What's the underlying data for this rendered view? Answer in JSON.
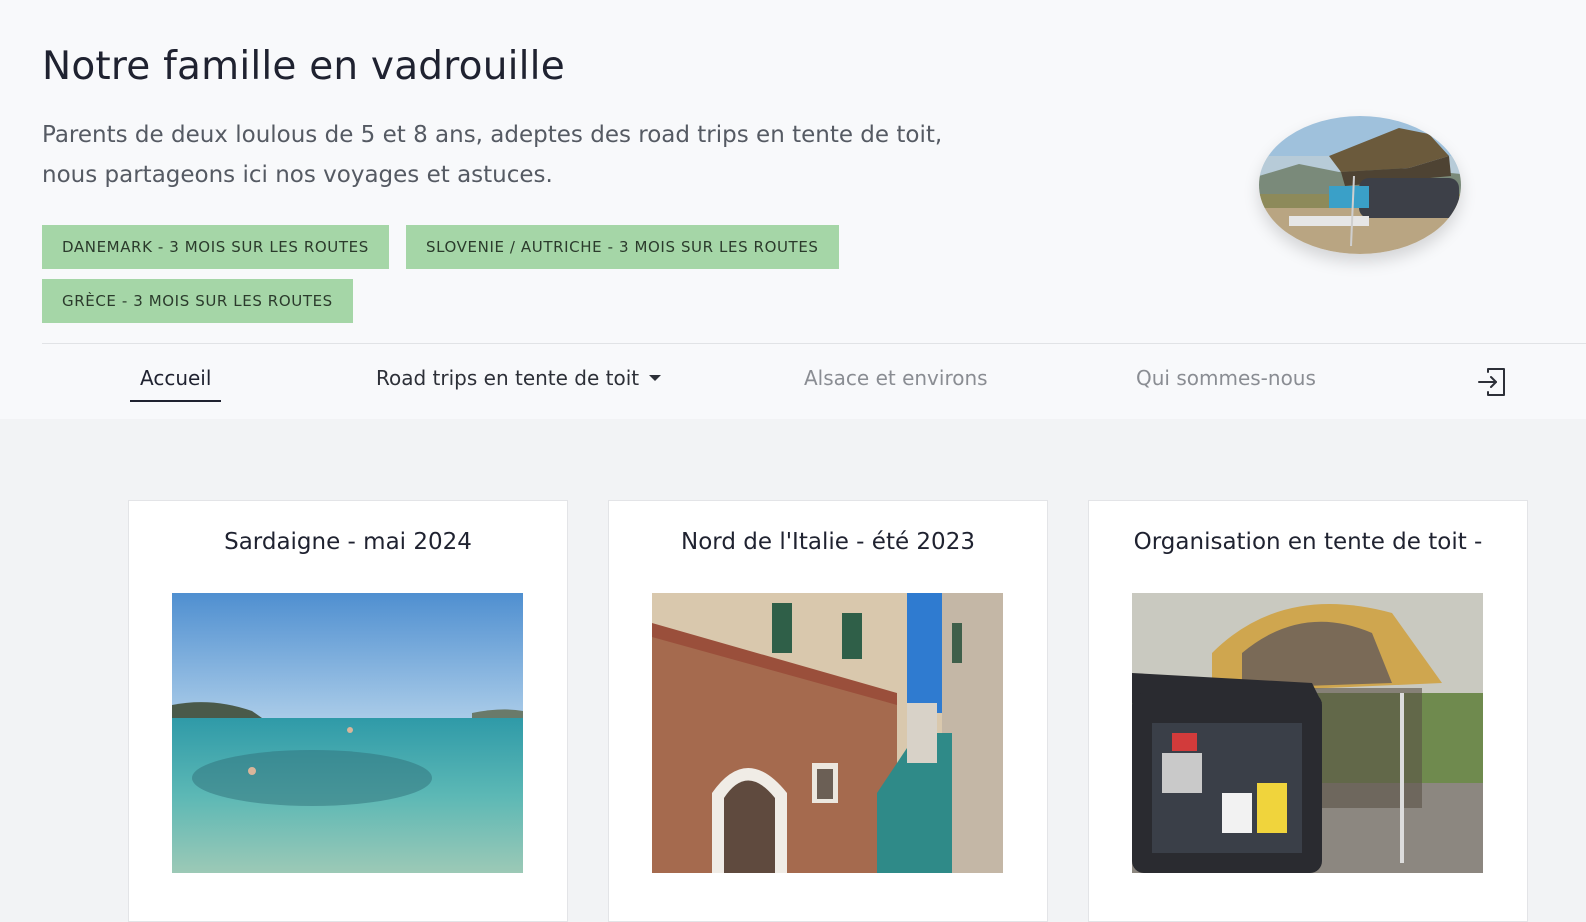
{
  "header": {
    "title": "Notre famille en vadrouille",
    "tagline_line1": "Parents de deux loulous de 5 et 8 ans, adeptes des road trips en tente de toit,",
    "tagline_line2": "nous partageons ici nos voyages et astuces.",
    "tags": [
      "DANEMARK - 3 MOIS SUR LES ROUTES",
      "SLOVENIE / AUTRICHE - 3 MOIS SUR LES ROUTES",
      "GRÈCE - 3 MOIS SUR LES ROUTES"
    ]
  },
  "nav": {
    "items": [
      "Accueil",
      "Road trips en tente de toit",
      "Alsace et environs",
      "Qui sommes-nous"
    ],
    "active": "Accueil",
    "login_icon": "login-icon"
  },
  "cards": [
    {
      "title": "Sardaigne - mai 2024"
    },
    {
      "title": "Nord de l'Italie - été 2023"
    },
    {
      "title": "Organisation en tente de toit -"
    }
  ],
  "colors": {
    "tag_bg": "#a5d6a7",
    "header_bg": "#f8f9fb",
    "page_bg": "#f2f3f5"
  }
}
